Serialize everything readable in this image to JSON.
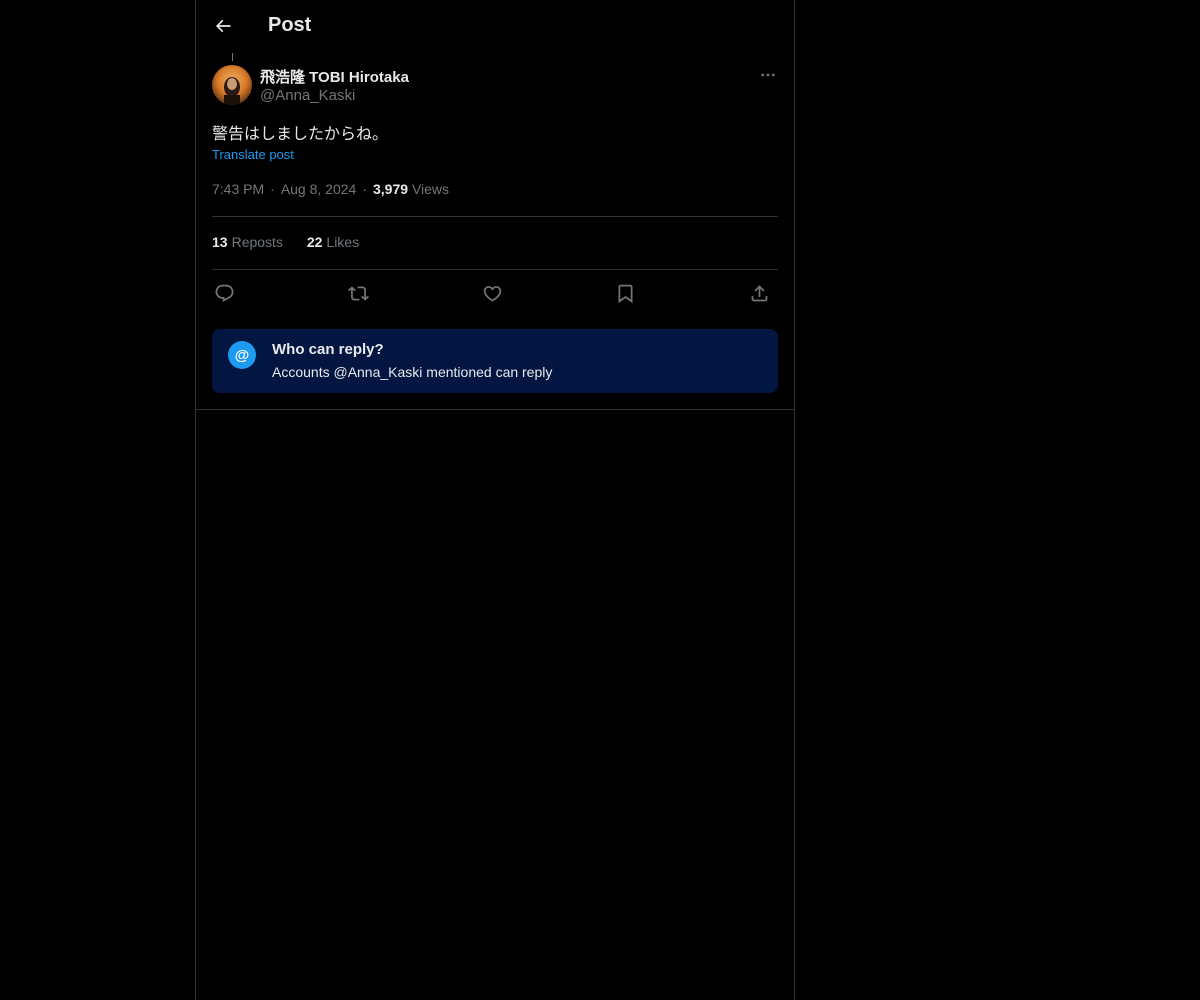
{
  "header": {
    "title": "Post",
    "back_icon": "arrow-left-icon"
  },
  "post": {
    "author_name": "飛浩隆 TOBI Hirotaka",
    "author_handle": "@Anna_Kaski",
    "text": "警告はしましたからね。",
    "translate_label": "Translate post",
    "time": "7:43 PM",
    "date": "Aug 8, 2024",
    "views_count": "3,979",
    "views_label": "Views",
    "reposts_count": "13",
    "reposts_label": "Reposts",
    "likes_count": "22",
    "likes_label": "Likes",
    "meta_separator": "·"
  },
  "actions": [
    {
      "name": "reply",
      "icon": "reply-icon"
    },
    {
      "name": "repost",
      "icon": "repost-icon"
    },
    {
      "name": "like",
      "icon": "heart-icon"
    },
    {
      "name": "bookmark",
      "icon": "bookmark-icon"
    },
    {
      "name": "share",
      "icon": "share-icon"
    }
  ],
  "reply_restriction": {
    "icon_glyph": "@",
    "title": "Who can reply?",
    "description": "Accounts @Anna_Kaski mentioned can reply"
  },
  "colors": {
    "background": "#000000",
    "text_primary": "#e7e9ea",
    "text_secondary": "#71767b",
    "accent": "#1d9bf0",
    "card_background": "#031642",
    "border": "#2f3336"
  }
}
